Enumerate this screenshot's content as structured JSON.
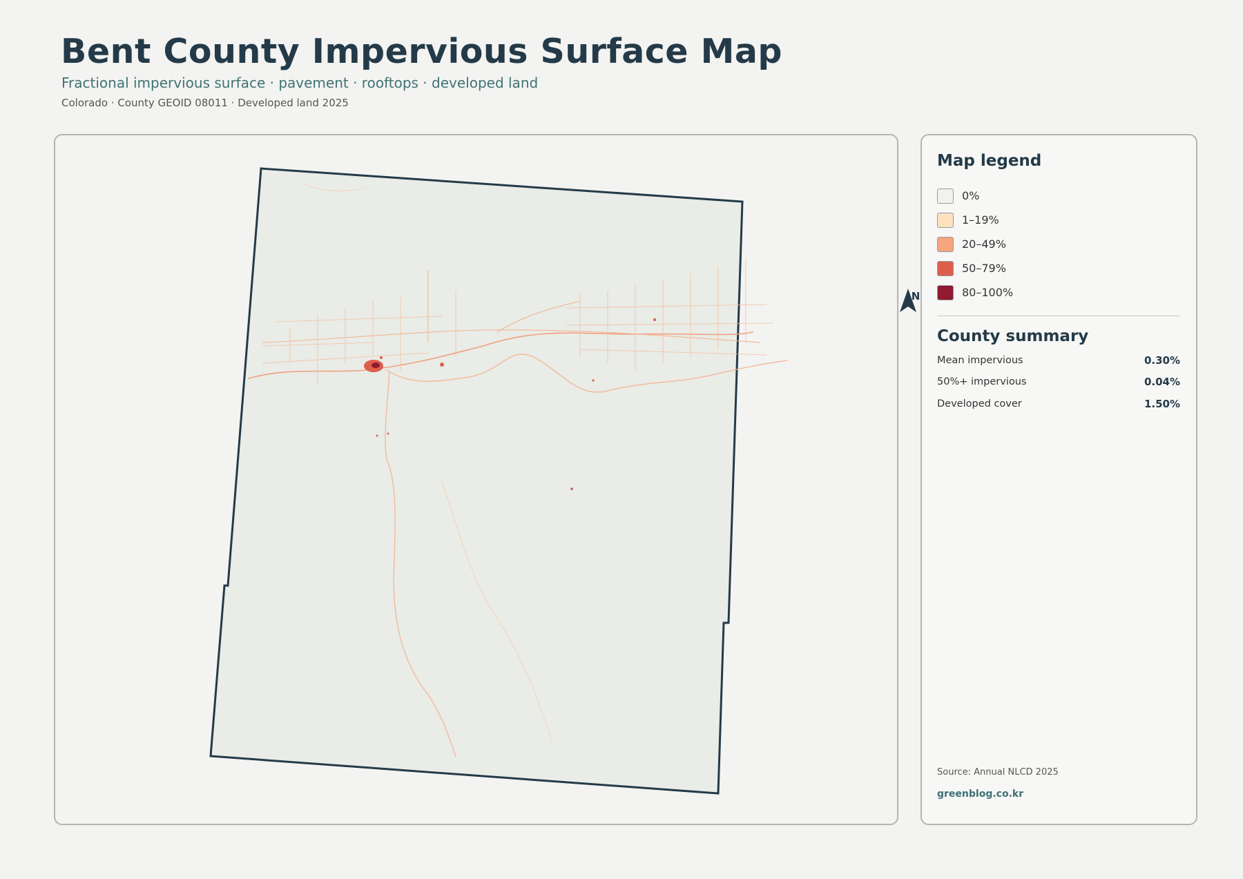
{
  "header": {
    "title": "Bent County Impervious Surface Map",
    "subtitle": "Fractional impervious surface · pavement · rooftops · developed land",
    "meta": "Colorado · County GEOID 08011 · Developed land 2025"
  },
  "map": {
    "north_label": "N",
    "boundary_color": "#243a48",
    "land_color": "#e9ece7"
  },
  "legend": {
    "title": "Map legend",
    "items": [
      {
        "label": "0%",
        "color": "#f1f1ef"
      },
      {
        "label": "1–19%",
        "color": "#fde2c1"
      },
      {
        "label": "20–49%",
        "color": "#f6a67f"
      },
      {
        "label": "50–79%",
        "color": "#de5e4c"
      },
      {
        "label": "80–100%",
        "color": "#8f1a32"
      }
    ]
  },
  "summary": {
    "title": "County summary",
    "rows": [
      {
        "label": "Mean impervious",
        "value": "0.30%"
      },
      {
        "label": "50%+ impervious",
        "value": "0.04%"
      },
      {
        "label": "Developed cover",
        "value": "1.50%"
      }
    ]
  },
  "footer": {
    "source": "Source: Annual NLCD 2025",
    "site": "greenblog.co.kr"
  }
}
